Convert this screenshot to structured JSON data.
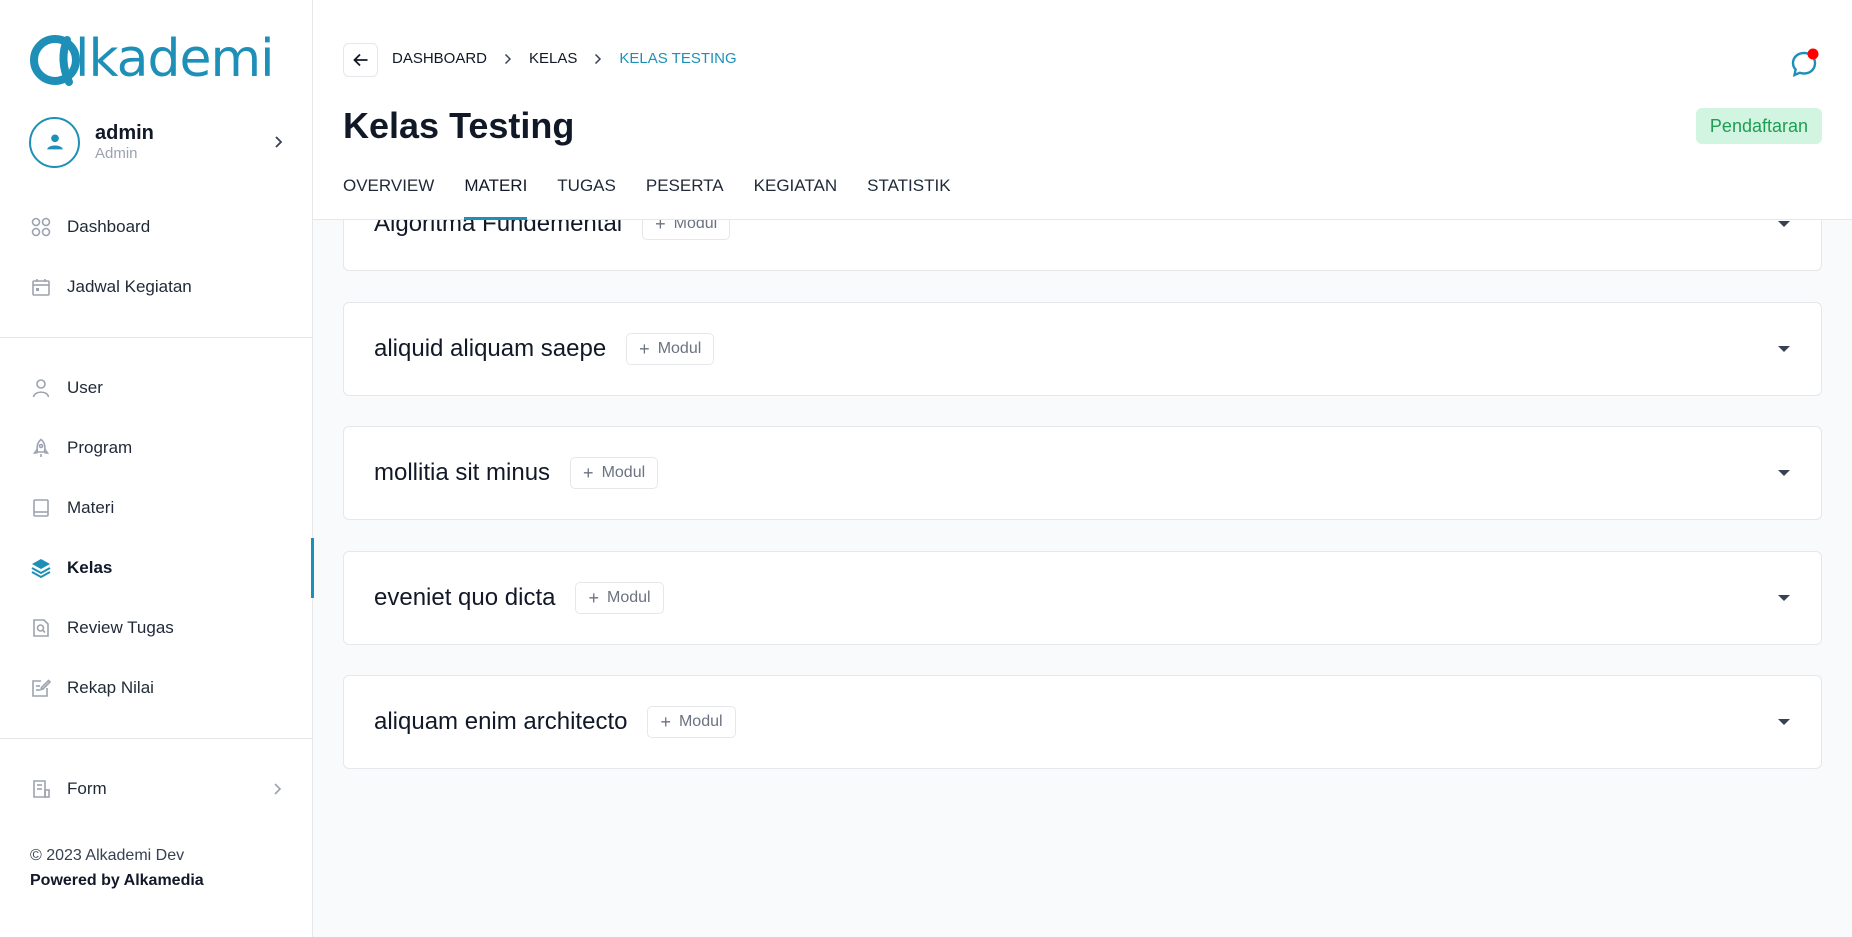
{
  "brand": {
    "logo_text": "lkademi",
    "logo_color": "#1e90b8"
  },
  "user": {
    "name": "admin",
    "role": "Admin"
  },
  "sidebar": {
    "group1": [
      {
        "label": "Dashboard",
        "icon": "grid-icon"
      },
      {
        "label": "Jadwal Kegiatan",
        "icon": "calendar-icon"
      }
    ],
    "group2": [
      {
        "label": "User",
        "icon": "user-icon"
      },
      {
        "label": "Program",
        "icon": "rocket-icon"
      },
      {
        "label": "Materi",
        "icon": "book-icon"
      },
      {
        "label": "Kelas",
        "icon": "layers-icon",
        "active": true
      },
      {
        "label": "Review Tugas",
        "icon": "review-icon"
      },
      {
        "label": "Rekap Nilai",
        "icon": "edit-note-icon"
      }
    ],
    "group3": [
      {
        "label": "Form",
        "icon": "form-icon"
      }
    ]
  },
  "footer": {
    "copyright": "© 2023 Alkademi Dev",
    "powered": "Powered by Alkamedia"
  },
  "breadcrumb": [
    "DASHBOARD",
    "KELAS",
    "KELAS TESTING"
  ],
  "page_title": "Kelas Testing",
  "status_badge": "Pendaftaran",
  "tabs": [
    "OVERVIEW",
    "MATERI",
    "TUGAS",
    "PESERTA",
    "KEGIATAN",
    "STATISTIK"
  ],
  "active_tab": "MATERI",
  "sections": [
    {
      "title": "Algoritma Fundemental",
      "button": "Modul"
    },
    {
      "title": "aliquid aliquam saepe",
      "button": "Modul"
    },
    {
      "title": "mollitia sit minus",
      "button": "Modul"
    },
    {
      "title": "eveniet quo dicta",
      "button": "Modul"
    },
    {
      "title": "aliquam enim architecto",
      "button": "Modul"
    }
  ],
  "colors": {
    "accent": "#1e90b8",
    "badge_bg": "#d1f5e0",
    "badge_text": "#1f9d55",
    "notification_dot": "#ff0000"
  }
}
